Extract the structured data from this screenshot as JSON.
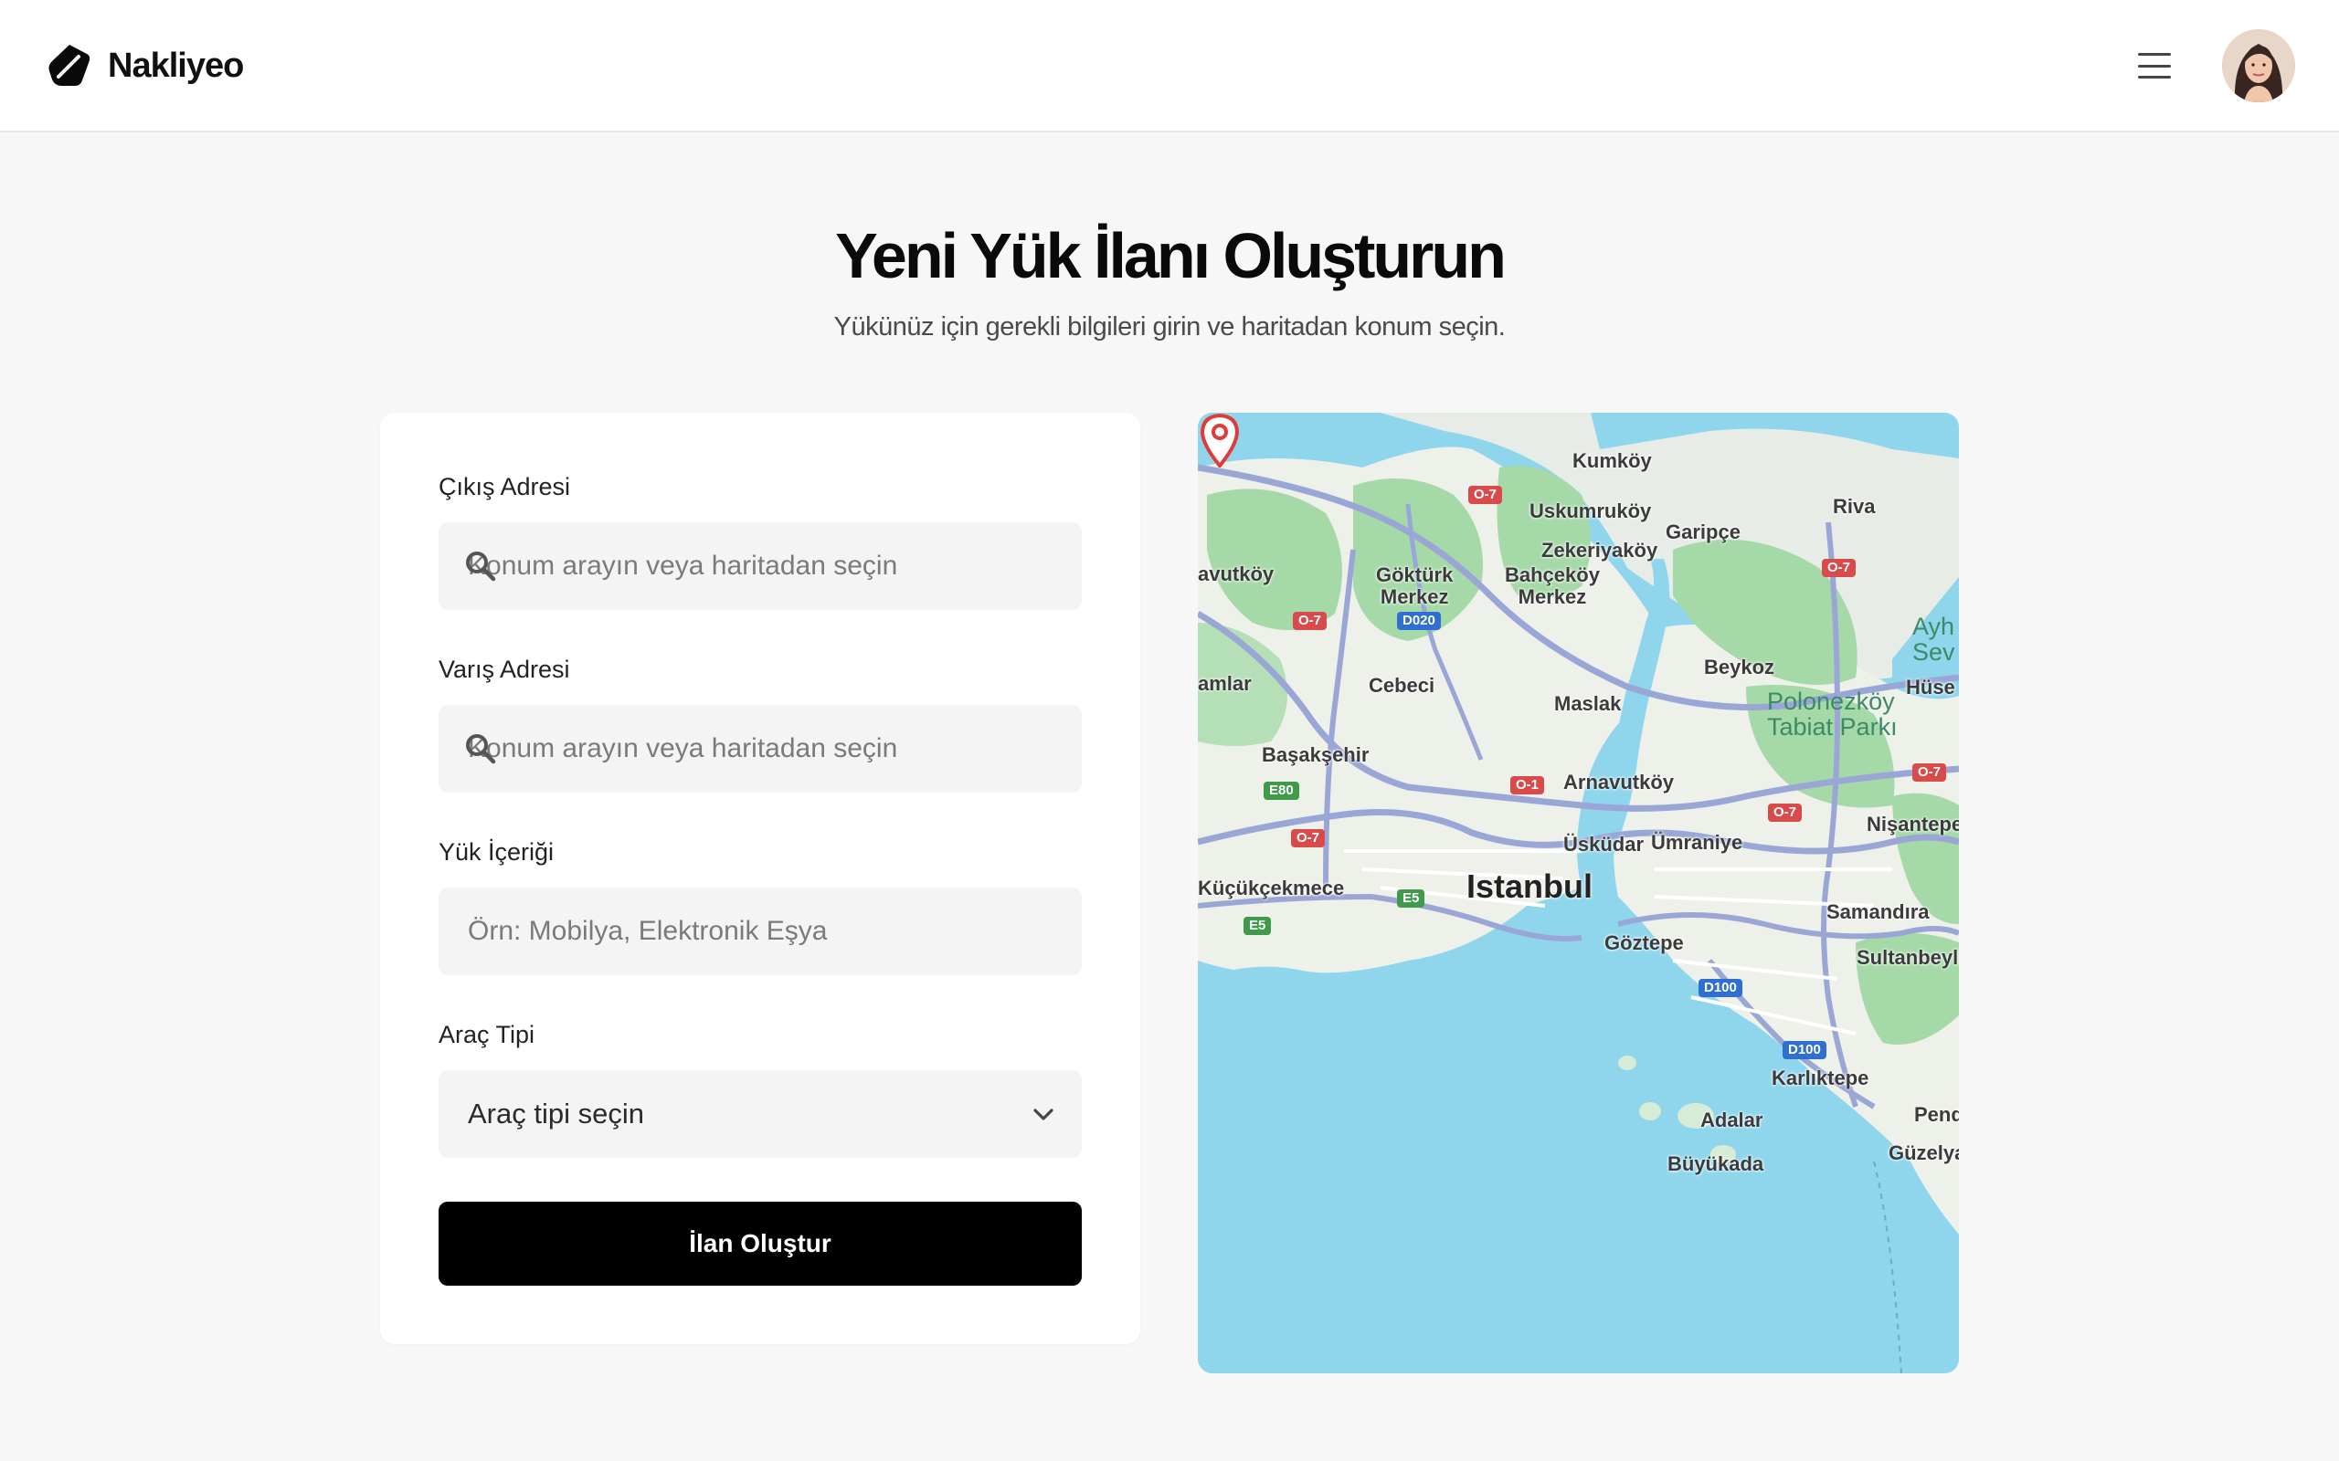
{
  "header": {
    "brand_name": "Nakliyeo",
    "logo_icon": "tag-logo-icon",
    "menu_icon": "hamburger-menu-icon",
    "avatar_alt": "user-avatar"
  },
  "page": {
    "title": "Yeni Yük İlanı Oluşturun",
    "subtitle": "Yükünüz için gerekli bilgileri girin ve haritadan konum seçin."
  },
  "form": {
    "departure": {
      "label": "Çıkış Adresi",
      "placeholder": "Konum arayın veya haritadan seçin",
      "value": ""
    },
    "arrival": {
      "label": "Varış Adresi",
      "placeholder": "Konum arayın veya haritadan seçin",
      "value": ""
    },
    "cargo": {
      "label": "Yük İçeriği",
      "placeholder": "Örn: Mobilya, Elektronik Eşya",
      "value": ""
    },
    "vehicle": {
      "label": "Araç Tipi",
      "selected": "Araç tipi seçin"
    },
    "submit_label": "İlan Oluştur"
  },
  "map": {
    "labels": {
      "kumkoy": "Kumköy",
      "uskumrukoy": "Uskumruköy",
      "garipce": "Garipçe",
      "riva": "Riva",
      "zekeriyakoy": "Zekeriyaköy",
      "avutkoy": "avutköy",
      "gokturk": "Göktürk\nMerkez",
      "bahcekoy": "Bahçeköy\nMerkez",
      "ayh": "Ayh\nSev",
      "beykoz": "Beykoz",
      "amlar": "amlar",
      "cebeci": "Cebeci",
      "maslak": "Maslak",
      "huse": "Hüse",
      "polonezkoy": "Polonezköy\nTabiat Parkı",
      "basaksehir": "Başakşehir",
      "arnavutkoy": "Arnavutköy",
      "nisantepe": "Nişantepe",
      "uskudar": "Üsküdar",
      "umraniye": "Ümraniye",
      "istanbul": "Istanbul",
      "kucukcekmece": "Küçükçekmece",
      "samandira": "Samandıra",
      "goztepe": "Göztepe",
      "sultanbeyli": "Sultanbeyli",
      "karliktepe": "Karlıktepe",
      "pendik": "Pendik",
      "adalar": "Adalar",
      "buyukada": "Büyükada",
      "guzelyali": "Güzelyal"
    },
    "badges": {
      "o7a": "O-7",
      "o7b": "O-7",
      "o7c": "O-7",
      "o7d": "O-7",
      "o7e": "O-7",
      "o7f": "O-7",
      "o1": "O-1",
      "d020": "D020",
      "e80": "E80",
      "e5a": "E5",
      "e5b": "E5",
      "d100a": "D100",
      "d100b": "D100"
    }
  }
}
